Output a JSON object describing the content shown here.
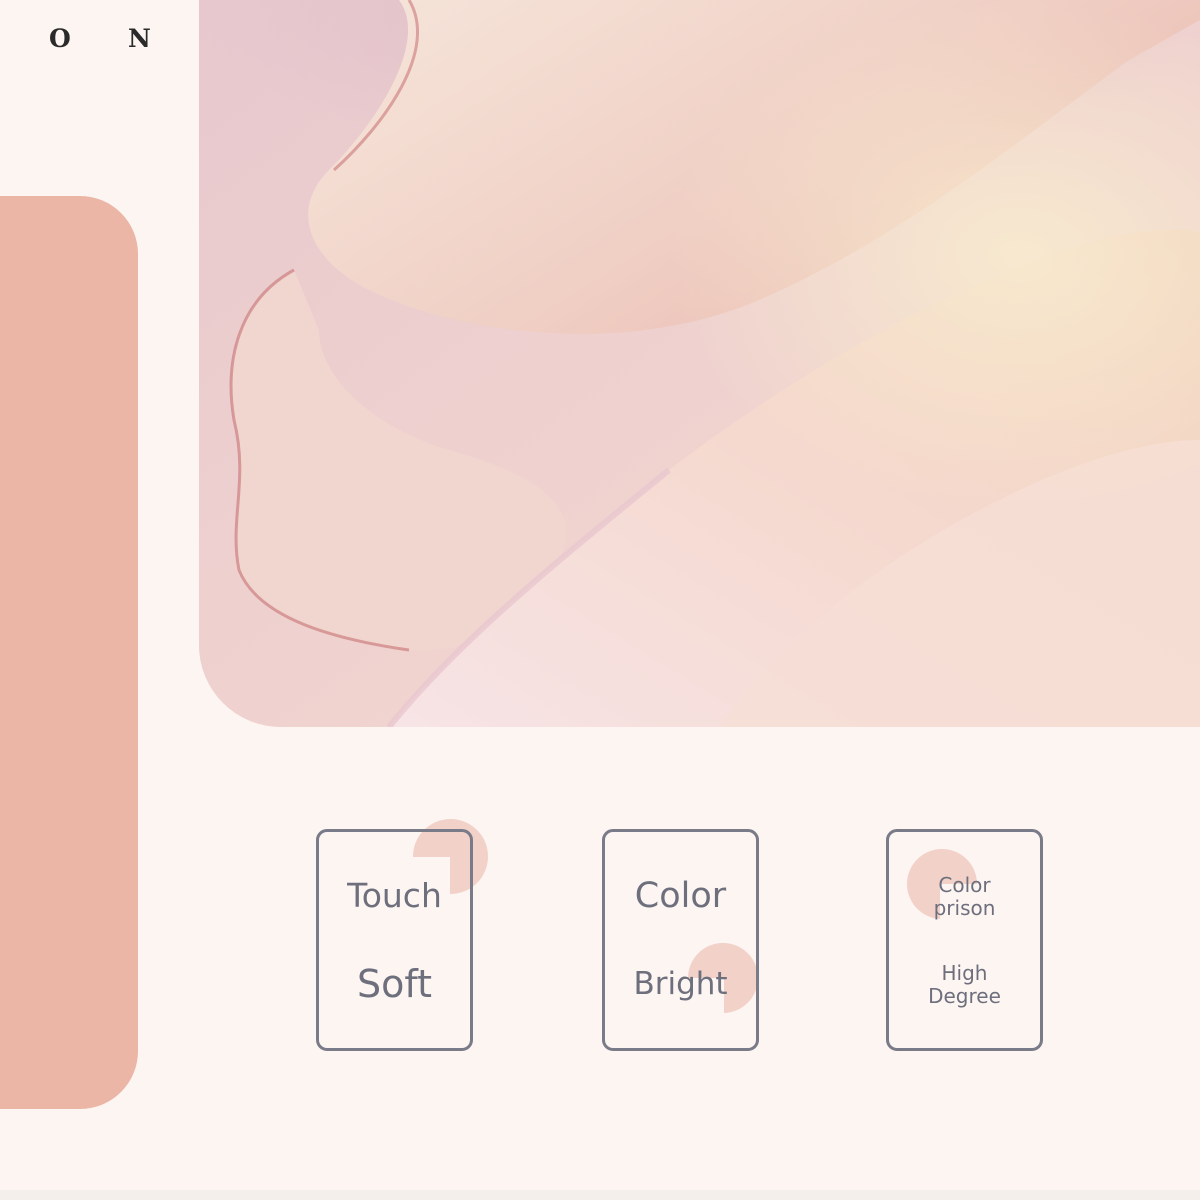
{
  "brand": {
    "letter_left": "O",
    "letter_right": "N"
  },
  "cards": [
    {
      "top": "Touch",
      "bottom": "Soft"
    },
    {
      "top": "Color",
      "bottom": "Bright"
    },
    {
      "top_line1": "Color",
      "top_line2": "prison",
      "bottom_line1": "High",
      "bottom_line2": "Degree"
    }
  ],
  "colors": {
    "background": "#FDF5F2",
    "side_panel": "#EBB6A6",
    "card_border": "#7A7B88",
    "card_text": "#6E6F7D",
    "accent_circle": "#F2D1C8"
  }
}
